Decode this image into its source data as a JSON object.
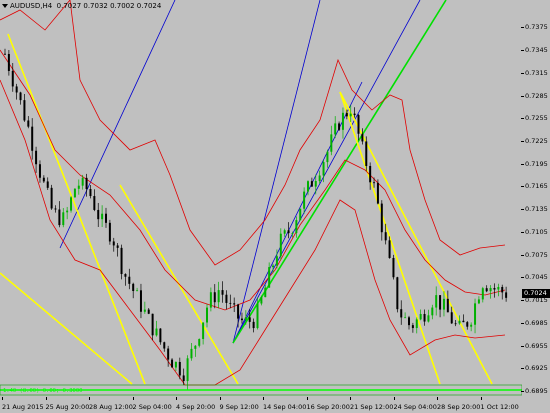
{
  "window": {
    "symbol_timeframe": "AUDUSD,H4",
    "ohlc": "0.7027 0.7032 0.7002 0.7024"
  },
  "price_axis": {
    "ticks": [
      "0.7375",
      "0.7345",
      "0.7315",
      "0.7285",
      "0.7255",
      "0.7225",
      "0.7195",
      "0.7165",
      "0.7135",
      "0.7105",
      "0.7075",
      "0.7045",
      "0.7015",
      "0.6985",
      "0.6955",
      "0.6925",
      "0.6895"
    ],
    "current_price": "0.7024",
    "range": [
      0.6887,
      0.7411
    ]
  },
  "time_axis": {
    "labels": [
      "21 Aug 2015",
      "25 Aug 20:00",
      "28 Aug 12:00",
      "2 Sep 04:00",
      "4 Sep 20:00",
      "9 Sep 12:00",
      "14 Sep 04:00",
      "16 Sep 20:00",
      "21 Sep 12:00",
      "24 Sep 04:00",
      "28 Sep 20:00",
      "1 Oct 12:00"
    ]
  },
  "indicator": {
    "readout": "1.40 (8.00) 0.00; 0.3000"
  },
  "colors": {
    "background": "#c0c0c0",
    "bull_candle": "#00b000",
    "bear_candle": "#000000",
    "bands": "#e00000",
    "fan_blue": "#0000d0",
    "trend_green": "#00e000",
    "trend_yellow": "#ffff00",
    "indicator_line": "#00ff00"
  },
  "chart_data": {
    "type": "candlestick",
    "symbol": "AUDUSD",
    "timeframe": "H4",
    "ylim": [
      0.6887,
      0.7411
    ],
    "x": [
      "21 Aug 2015",
      "25 Aug 20:00",
      "28 Aug 12:00",
      "2 Sep 04:00",
      "4 Sep 20:00",
      "9 Sep 12:00",
      "14 Sep 04:00",
      "16 Sep 20:00",
      "21 Sep 12:00",
      "24 Sep 04:00",
      "28 Sep 20:00",
      "1 Oct 12:00"
    ],
    "close_path": [
      0.734,
      0.729,
      0.724,
      0.718,
      0.713,
      0.712,
      0.717,
      0.716,
      0.712,
      0.71,
      0.705,
      0.702,
      0.699,
      0.696,
      0.6935,
      0.692,
      0.696,
      0.701,
      0.703,
      0.7,
      0.6985,
      0.699,
      0.704,
      0.709,
      0.711,
      0.715,
      0.718,
      0.721,
      0.725,
      0.727,
      0.721,
      0.716,
      0.708,
      0.7,
      0.698,
      0.6995,
      0.702,
      0.7,
      0.6975,
      0.699,
      0.704,
      0.703,
      0.7024
    ],
    "current_price": 0.7024
  }
}
